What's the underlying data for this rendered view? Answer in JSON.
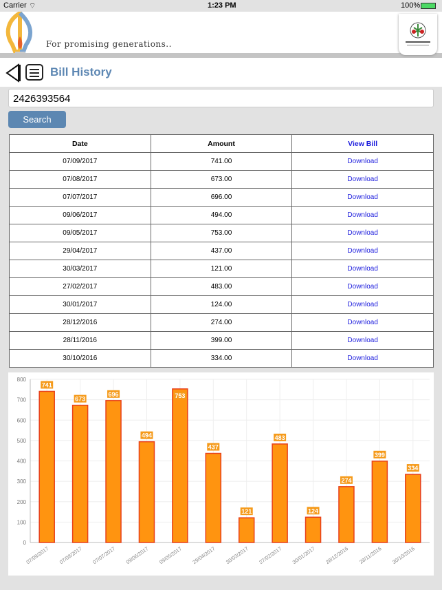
{
  "status_bar": {
    "carrier": "Carrier",
    "time": "1:23 PM",
    "battery": "100%"
  },
  "banner": {
    "tagline": "For promising generations.."
  },
  "navbar": {
    "title": "Bill History",
    "back_icon": "back-triangle-icon",
    "menu_icon": "hamburger-menu-icon"
  },
  "search": {
    "account_value": "2426393564",
    "button_label": "Search"
  },
  "table": {
    "headers": [
      "Date",
      "Amount",
      "View Bill"
    ],
    "rows": [
      [
        "07/09/2017",
        "741.00",
        "Download"
      ],
      [
        "07/08/2017",
        "673.00",
        "Download"
      ],
      [
        "07/07/2017",
        "696.00",
        "Download"
      ],
      [
        "09/06/2017",
        "494.00",
        "Download"
      ],
      [
        "09/05/2017",
        "753.00",
        "Download"
      ],
      [
        "29/04/2017",
        "437.00",
        "Download"
      ],
      [
        "30/03/2017",
        "121.00",
        "Download"
      ],
      [
        "27/02/2017",
        "483.00",
        "Download"
      ],
      [
        "30/01/2017",
        "124.00",
        "Download"
      ],
      [
        "28/12/2016",
        "274.00",
        "Download"
      ],
      [
        "28/11/2016",
        "399.00",
        "Download"
      ],
      [
        "30/10/2016",
        "334.00",
        "Download"
      ]
    ]
  },
  "chart_data": {
    "type": "bar",
    "categories": [
      "07/09/2017",
      "07/08/2017",
      "07/07/2017",
      "09/06/2017",
      "09/05/2017",
      "29/04/2017",
      "30/03/2017",
      "27/02/2017",
      "30/01/2017",
      "28/12/2016",
      "28/11/2016",
      "30/10/2016"
    ],
    "values": [
      741,
      673,
      696,
      494,
      753,
      437,
      121,
      483,
      124,
      274,
      399,
      334
    ],
    "ylim": [
      0,
      800
    ],
    "yticks": [
      0,
      100,
      200,
      300,
      400,
      500,
      600,
      700,
      800
    ],
    "grid": true,
    "bar_color": "#ff9410",
    "bar_border": "#e8401a",
    "label_bg": "#f59a1a"
  }
}
